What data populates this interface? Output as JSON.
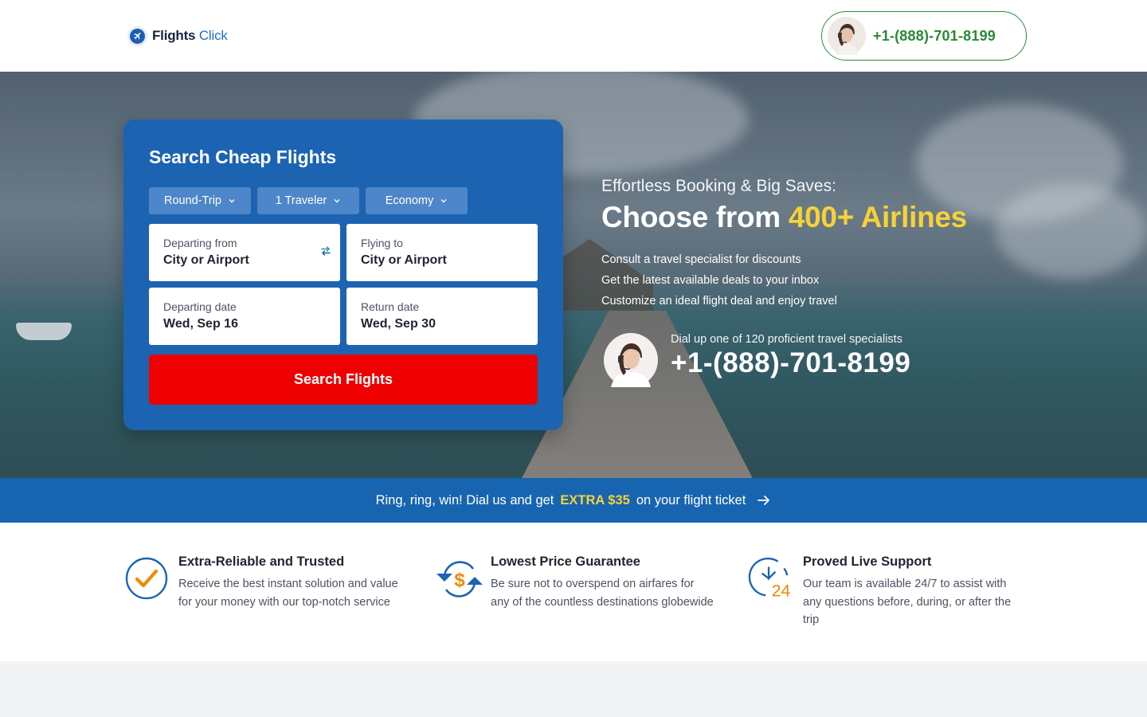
{
  "header": {
    "brand_first": "Flights",
    "brand_second": "Click",
    "phone": "+1-(888)-701-8199"
  },
  "search": {
    "title": "Search Cheap Flights",
    "trip_type": "Round-Trip",
    "travelers": "1 Traveler",
    "cabin": "Economy",
    "from_label": "Departing from",
    "from_value": "City or Airport",
    "to_label": "Flying to",
    "to_value": "City or Airport",
    "depart_label": "Departing date",
    "depart_value": "Wed, Sep 16",
    "return_label": "Return date",
    "return_value": "Wed, Sep 30",
    "submit": "Search Flights"
  },
  "hero": {
    "eyebrow": "Effortless Booking & Big Saves:",
    "headline_prefix": "Choose from ",
    "headline_highlight": "400+ Airlines",
    "bullets": [
      "Consult a travel specialist for discounts",
      "Get the latest available deals to your inbox",
      "Customize an ideal flight deal and enjoy travel"
    ],
    "agent_note": "Dial up one of 120 proficient travel specialists",
    "agent_phone": "+1-(888)-701-8199"
  },
  "promo": {
    "text_before": "Ring, ring, win! Dial us and get",
    "highlight": "EXTRA $35",
    "text_after": "on your flight ticket"
  },
  "features": [
    {
      "icon": "checkmark-circle-icon",
      "title": "Extra-Reliable and Trusted",
      "description": "Receive the best instant solution and value for your money with our top-notch service"
    },
    {
      "icon": "dollar-refresh-icon",
      "title": "Lowest Price Guarantee",
      "description": "Be sure not to overspend on airfares for any of the countless destinations globewide"
    },
    {
      "icon": "clock-24-icon",
      "title": "Proved Live Support",
      "description": "Our team is available 24/7 to assist with any questions before, during, or after the trip"
    }
  ],
  "colors": {
    "brand_blue": "#1c63b2",
    "promo_blue": "#1765b1",
    "cta_red": "#ee0000",
    "highlight_yellow": "#f7d237",
    "phone_green": "#2a8a35",
    "icon_orange": "#f08a00"
  }
}
